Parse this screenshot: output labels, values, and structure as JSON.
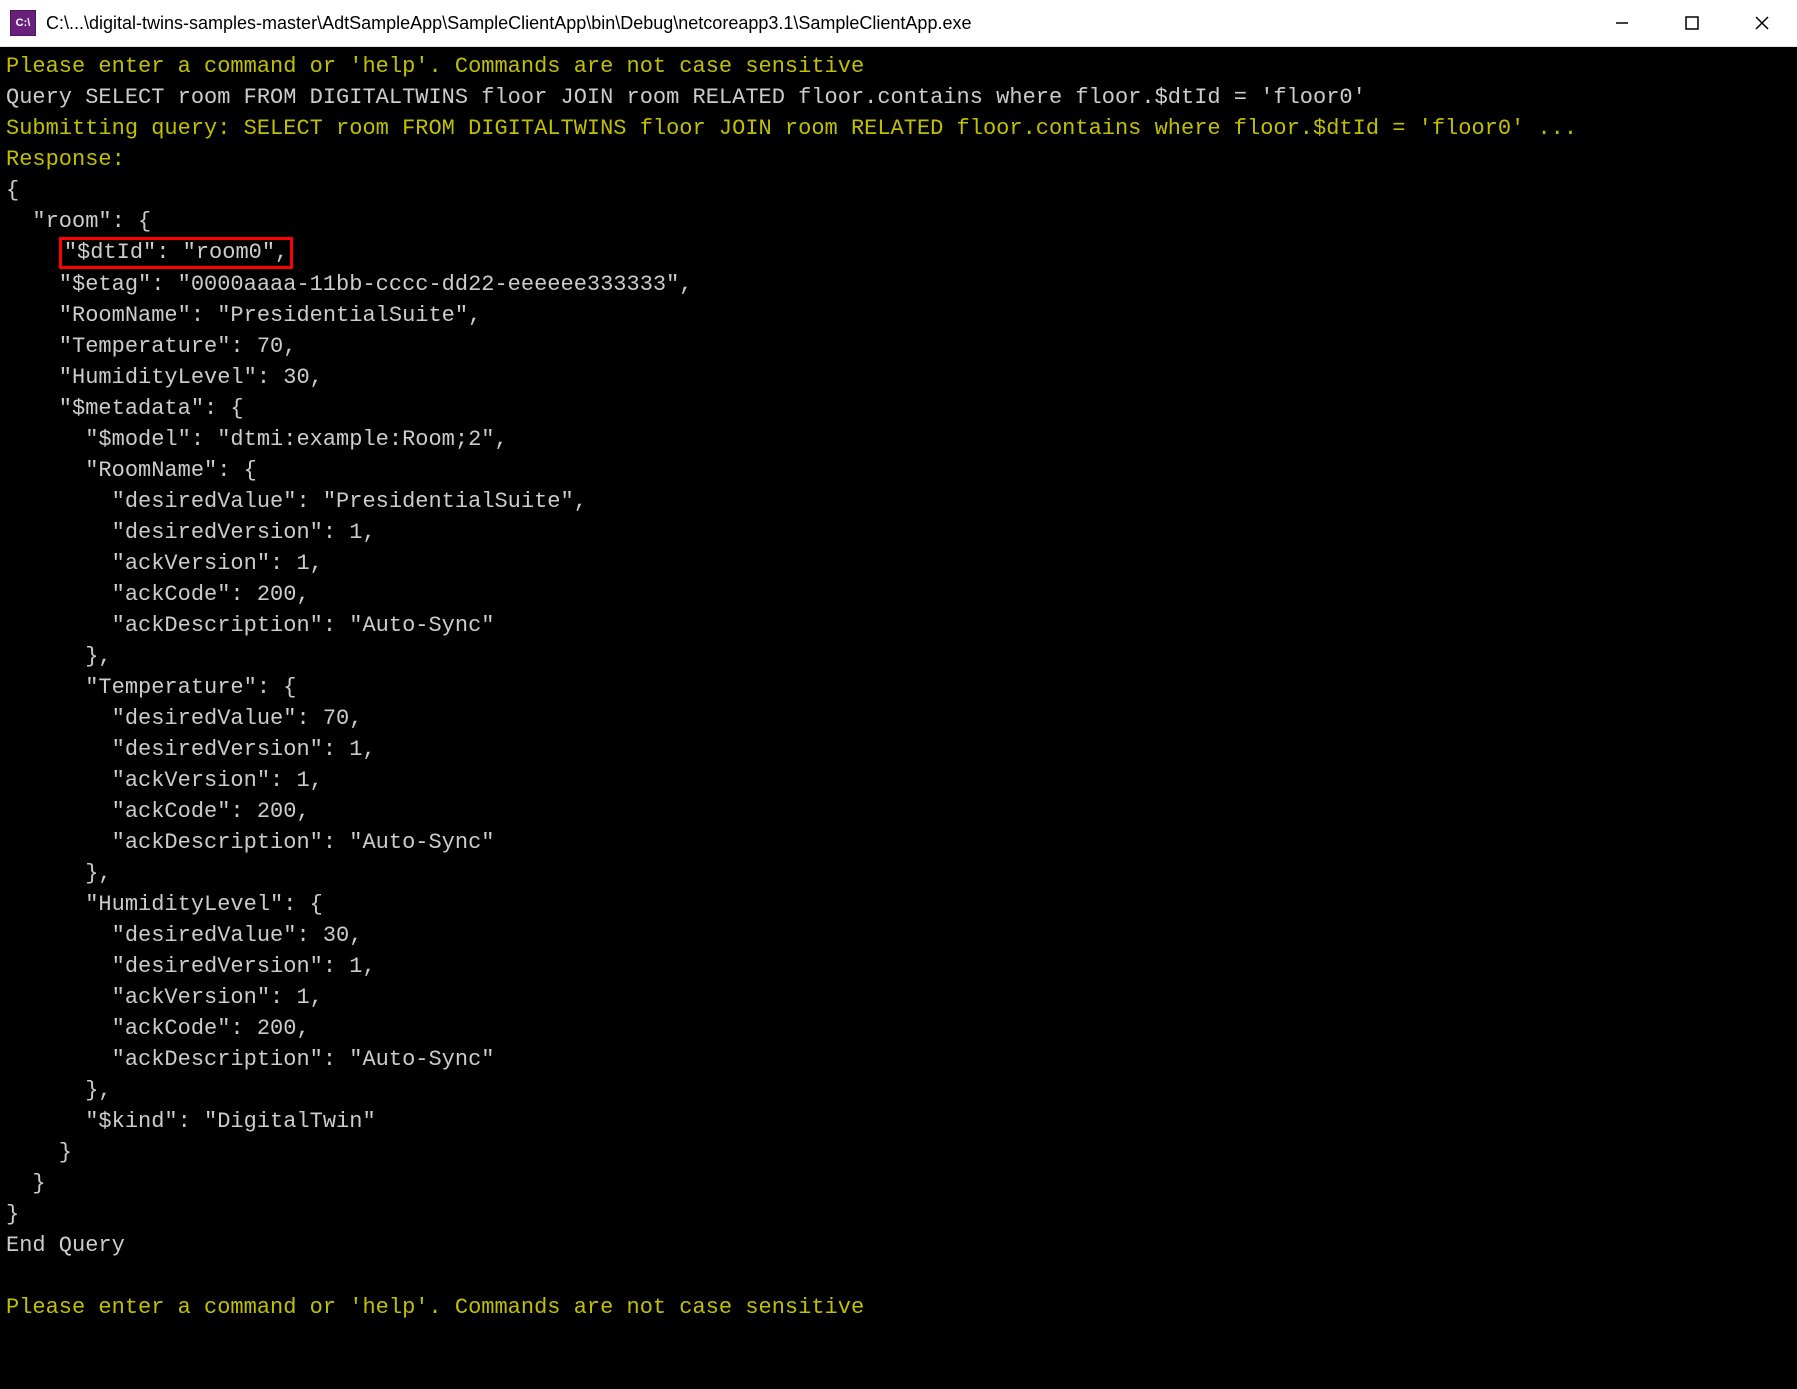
{
  "window": {
    "icon_label": "C:\\",
    "title": "C:\\...\\digital-twins-samples-master\\AdtSampleApp\\SampleClientApp\\bin\\Debug\\netcoreapp3.1\\SampleClientApp.exe"
  },
  "console": {
    "prompt1": "Please enter a command or 'help'. Commands are not case sensitive",
    "query_line": "Query SELECT room FROM DIGITALTWINS floor JOIN room RELATED floor.contains where floor.$dtId = 'floor0'",
    "submit_line": "Submitting query: SELECT room FROM DIGITALTWINS floor JOIN room RELATED floor.contains where floor.$dtId = 'floor0' ...",
    "response_label": "Response:",
    "json_open": "{",
    "room_open": "  \"room\": {",
    "dtId_line": "\"$dtId\": \"room0\",",
    "etag_line": "    \"$etag\": \"0000aaaa-11bb-cccc-dd22-eeeeee333333\",",
    "roomname_line": "    \"RoomName\": \"PresidentialSuite\",",
    "temp_line": "    \"Temperature\": 70,",
    "humidity_line": "    \"HumidityLevel\": 30,",
    "meta_open": "    \"$metadata\": {",
    "model_line": "      \"$model\": \"dtmi:example:Room;2\",",
    "m_roomname_open": "      \"RoomName\": {",
    "m_rn_dv": "        \"desiredValue\": \"PresidentialSuite\",",
    "m_rn_dver": "        \"desiredVersion\": 1,",
    "m_rn_av": "        \"ackVersion\": 1,",
    "m_rn_ac": "        \"ackCode\": 200,",
    "m_rn_ad": "        \"ackDescription\": \"Auto-Sync\"",
    "m_rn_close": "      },",
    "m_temp_open": "      \"Temperature\": {",
    "m_t_dv": "        \"desiredValue\": 70,",
    "m_t_dver": "        \"desiredVersion\": 1,",
    "m_t_av": "        \"ackVersion\": 1,",
    "m_t_ac": "        \"ackCode\": 200,",
    "m_t_ad": "        \"ackDescription\": \"Auto-Sync\"",
    "m_t_close": "      },",
    "m_hum_open": "      \"HumidityLevel\": {",
    "m_h_dv": "        \"desiredValue\": 30,",
    "m_h_dver": "        \"desiredVersion\": 1,",
    "m_h_av": "        \"ackVersion\": 1,",
    "m_h_ac": "        \"ackCode\": 200,",
    "m_h_ad": "        \"ackDescription\": \"Auto-Sync\"",
    "m_h_close": "      },",
    "kind_line": "      \"$kind\": \"DigitalTwin\"",
    "meta_close": "    }",
    "room_close": "  }",
    "json_close": "}",
    "end_query": "End Query",
    "blank": "",
    "prompt2": "Please enter a command or 'help'. Commands are not case sensitive"
  }
}
